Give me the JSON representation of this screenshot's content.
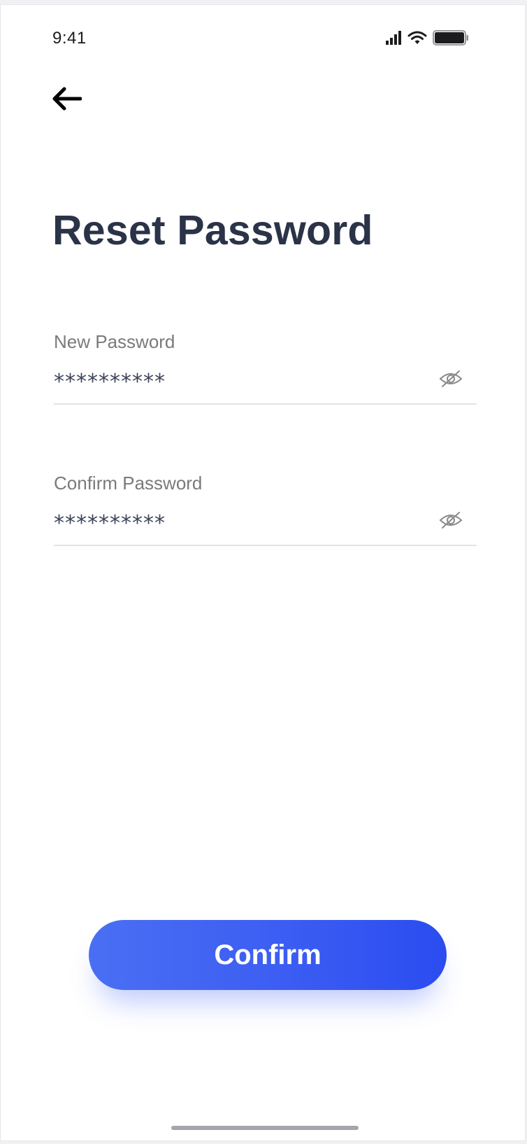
{
  "status_bar": {
    "time": "9:41",
    "icons": [
      "cellular-signal-icon",
      "wifi-icon",
      "battery-icon"
    ]
  },
  "nav": {
    "back_icon": "arrow-left-icon"
  },
  "title": "Reset Password",
  "fields": [
    {
      "label": "New Password",
      "value": "**********",
      "toggle_icon": "eye-off-icon"
    },
    {
      "label": "Confirm Password",
      "value": "**********",
      "toggle_icon": "eye-off-icon"
    }
  ],
  "confirm_button": {
    "label": "Confirm"
  },
  "colors": {
    "accent_start": "#4a6ff3",
    "accent_end": "#2b4cf0",
    "title": "#2b3348",
    "label": "#7a7a7a",
    "divider": "#e2e3e8"
  }
}
